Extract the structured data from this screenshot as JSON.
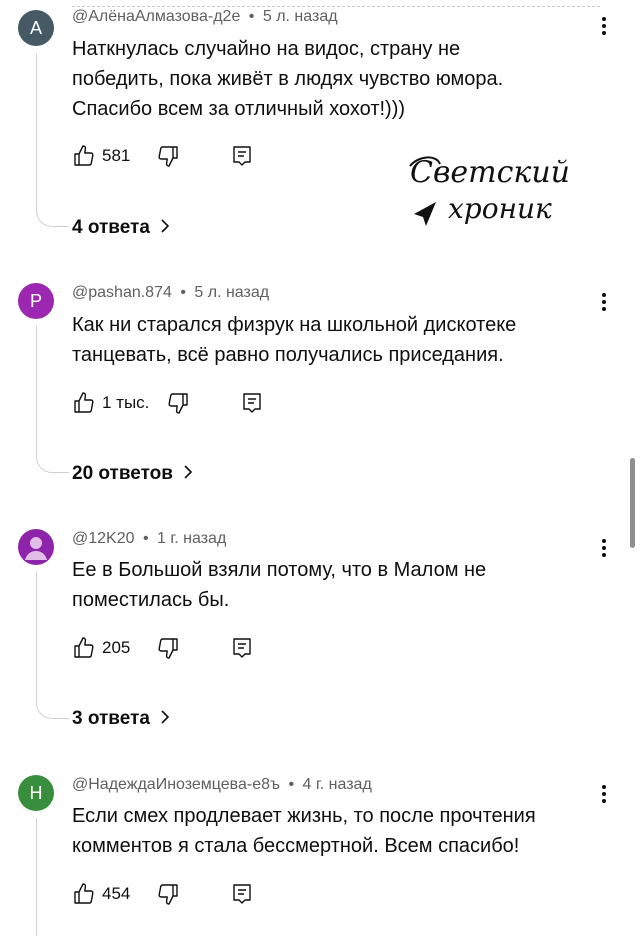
{
  "comments": [
    {
      "avatar_letter": "A",
      "avatar_color": "#455a64",
      "author": "@АлёнаАлмазова-д2е",
      "time": "5 л. назад",
      "text_lines": [
        "Наткнулась случайно на видос, страну не",
        "победить, пока живёт в людях чувство юмора.",
        "Спасибо всем за отличный хохот!)))"
      ],
      "likes": "581",
      "replies_label": "4 ответа"
    },
    {
      "avatar_letter": "P",
      "avatar_color": "#9c27b0",
      "author": "@pashan.874",
      "time": "5 л. назад",
      "text_lines": [
        "Как ни старался физрук на школьной дискотеке",
        "танцевать, всё равно получались приседания."
      ],
      "likes": "1 тыс.",
      "replies_label": "20 ответов"
    },
    {
      "avatar_letter": "",
      "avatar_color": "#8e24aa",
      "author": "@12K20",
      "time": "1 г. назад",
      "text_lines": [
        "Ее в Большой взяли потому, что в Малом не",
        "поместилась бы."
      ],
      "likes": "205",
      "replies_label": "3 ответа"
    },
    {
      "avatar_letter": "Н",
      "avatar_color": "#388e3c",
      "author": "@НадеждаИноземцева-е8ъ",
      "time": "4 г. назад",
      "text_lines": [
        "Если смех продлевает жизнь, то после прочтения",
        "комментов я стала бессмертной. Всем спасибо!"
      ],
      "likes": "454",
      "replies_label": ""
    }
  ],
  "meta_separator": "•",
  "watermark": {
    "line1": "Светский",
    "line2": "хроник"
  }
}
